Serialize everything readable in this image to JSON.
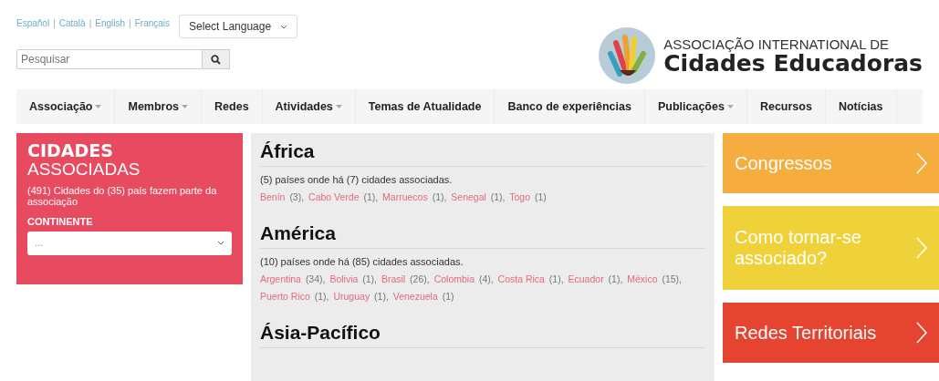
{
  "header": {
    "languages": [
      "Español",
      "Català",
      "English",
      "Français"
    ],
    "language_separator": "|",
    "language_select": "Select Language",
    "search": {
      "placeholder": "Pesquisar"
    },
    "logo": {
      "line1": "ASSOCIAÇÃO INTERNATIONAL DE",
      "line2": "Cidades Educadoras"
    }
  },
  "nav": [
    {
      "label": "Associação",
      "has_menu": true
    },
    {
      "label": "Membros",
      "has_menu": true
    },
    {
      "label": "Redes",
      "has_menu": false
    },
    {
      "label": "Atividades",
      "has_menu": true
    },
    {
      "label": "Temas de Atualidade",
      "has_menu": false
    },
    {
      "label": "Banco de experiências",
      "has_menu": false
    },
    {
      "label": "Publicações",
      "has_menu": true
    },
    {
      "label": "Recursos",
      "has_menu": false
    },
    {
      "label": "Notícias",
      "has_menu": false
    }
  ],
  "sidebar": {
    "title_bold": "CIDADES",
    "title_light": "ASSOCIADAS",
    "summary": "(491) Cidades do (35) país fazem parte da associação",
    "filter_label": "CONTINENTE",
    "filter_value": "..."
  },
  "continents": [
    {
      "name": "África",
      "summary": "(5) países onde há (7) cidades associadas.",
      "countries": [
        {
          "name": "Benín",
          "count": "(3),"
        },
        {
          "name": "Cabo Verde",
          "count": "(1),"
        },
        {
          "name": "Marruecos",
          "count": "(1),"
        },
        {
          "name": "Senegal",
          "count": "(1),"
        },
        {
          "name": "Togo",
          "count": "(1)"
        }
      ]
    },
    {
      "name": "América",
      "summary": "(10) países onde há (85) cidades associadas.",
      "countries": [
        {
          "name": "Argentina",
          "count": "(34),"
        },
        {
          "name": "Bolivia",
          "count": "(1),"
        },
        {
          "name": "Brasil",
          "count": "(26),"
        },
        {
          "name": "Colombia",
          "count": "(4),"
        },
        {
          "name": "Costa Rica",
          "count": "(1),"
        },
        {
          "name": "Ecuador",
          "count": "(1),"
        },
        {
          "name": "México",
          "count": "(15),"
        },
        {
          "name": "Puerto Rico",
          "count": "(1),"
        },
        {
          "name": "Uruguay",
          "count": "(1),"
        },
        {
          "name": "Venezuela",
          "count": "(1)"
        }
      ]
    },
    {
      "name": "Ásia-Pacífico"
    }
  ],
  "side_links": [
    {
      "label": "Congressos",
      "color": "#f5a936"
    },
    {
      "label": "Como tornar-se associado?",
      "color": "#efd030"
    },
    {
      "label": "Redes Territoriais",
      "color": "#e33b25"
    }
  ]
}
